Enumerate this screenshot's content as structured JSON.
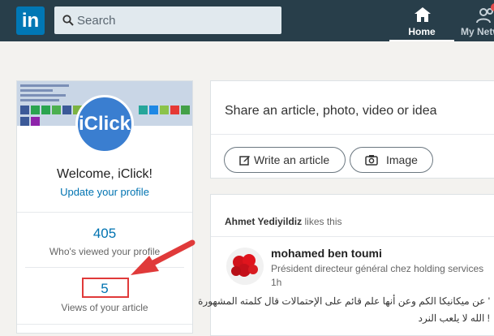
{
  "topbar": {
    "logo_text": "in",
    "search_placeholder": "Search",
    "nav": [
      {
        "label": "Home",
        "icon": "home-icon"
      },
      {
        "label": "My Netw",
        "icon": "people-icon"
      }
    ]
  },
  "profile": {
    "avatar_text": "iClick",
    "welcome": "Welcome, iClick!",
    "update_link": "Update your profile",
    "stats": [
      {
        "value": "405",
        "label": "Who's viewed your profile"
      },
      {
        "value": "5",
        "label": "Views of your article"
      }
    ]
  },
  "share": {
    "prompt": "Share an article, photo, video or idea",
    "write_button": "Write an article",
    "image_button": "Image"
  },
  "feed": {
    "actor": "Ahmet Yediyildiz",
    "action": "likes this",
    "author": "mohamed ben toumi",
    "author_title": "Président directeur général chez holding services",
    "time": "1h",
    "lines": [
      "' عن ميكانيكا الكم وعن أنها علم قائم على الإحتمالات قال كلمته المشهورة",
      "! الله لا يلعب النرد"
    ]
  },
  "colors": {
    "topbar": "#283e4a",
    "brand": "#0077b5",
    "link": "#0073b1",
    "annotation": "#e03a3a"
  }
}
